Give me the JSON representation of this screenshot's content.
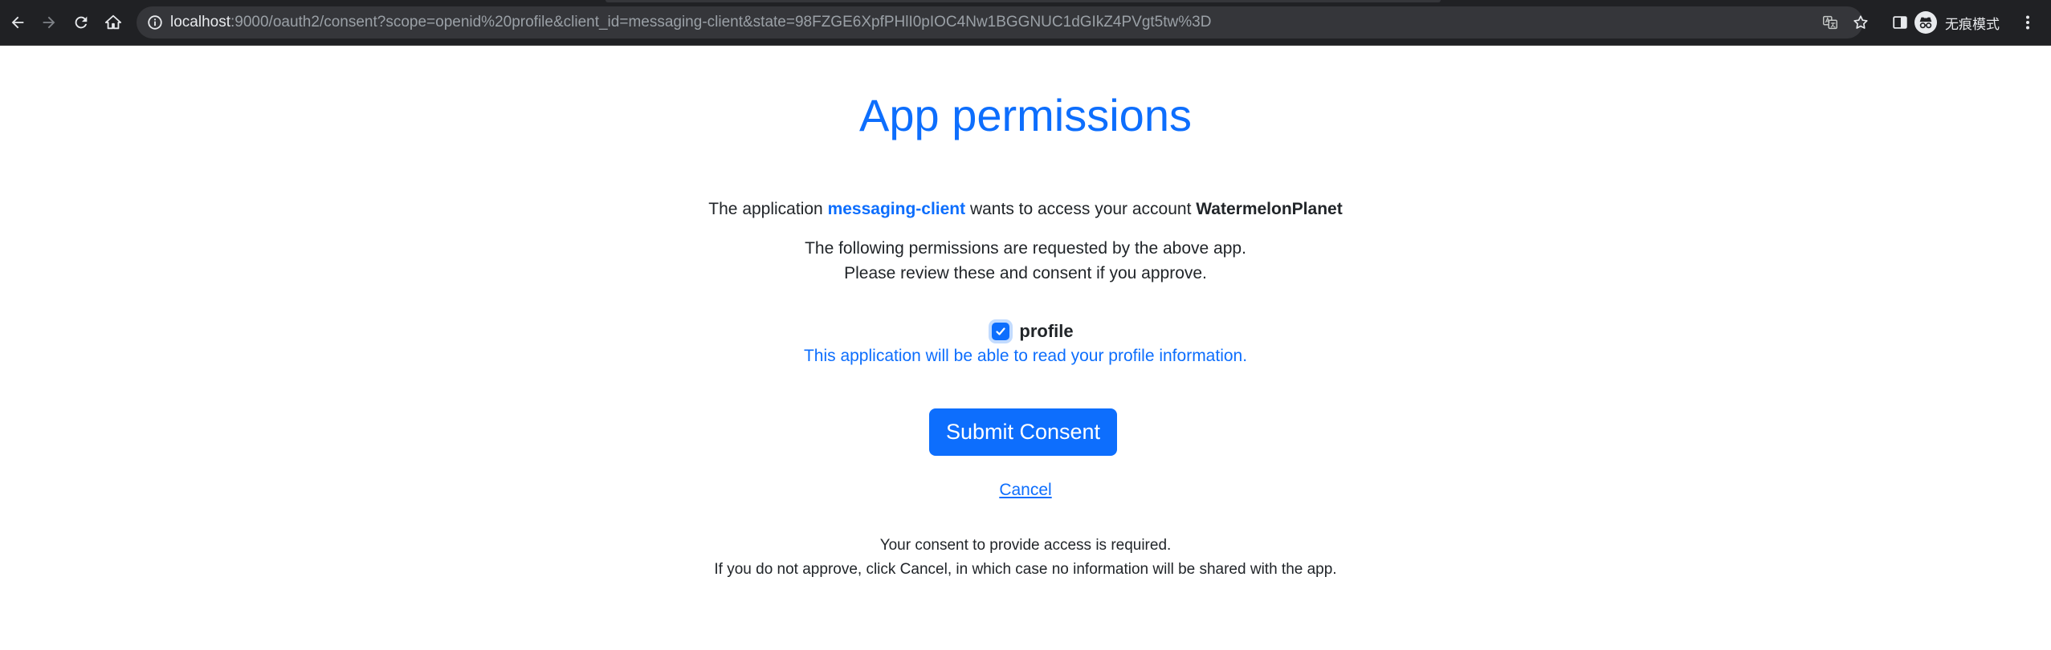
{
  "browser": {
    "url_host": "localhost",
    "url_rest": ":9000/oauth2/consent?scope=openid%20profile&client_id=messaging-client&state=98FZGE6XpfPHlI0pIOC4Nw1BGGNUC1dGIkZ4PVgt5tw%3D",
    "profile_label": "无痕模式",
    "icons": [
      "back-arrow-icon",
      "forward-arrow-icon",
      "reload-icon",
      "home-icon",
      "site-info-icon",
      "translate-icon",
      "bookmark-star-icon",
      "side-panel-icon",
      "incognito-icon",
      "menu-dots-icon"
    ],
    "colors": {
      "chrome_bg": "#202124",
      "omnibox_bg": "#35363a"
    }
  },
  "consent": {
    "title": "App permissions",
    "intro_prefix": "The application ",
    "client_id": "messaging-client",
    "intro_middle": " wants to access your account ",
    "account": "WatermelonPlanet",
    "request_line1": "The following permissions are requested by the above app.",
    "request_line2": "Please review these and consent if you approve.",
    "scope": {
      "name": "profile",
      "checked": true,
      "description": "This application will be able to read your profile information."
    },
    "submit_label": "Submit Consent",
    "cancel_label": "Cancel",
    "footer_line1": "Your consent to provide access is required.",
    "footer_line2": "If you do not approve, click Cancel, in which case no information will be shared with the app.",
    "colors": {
      "primary": "#0d6efd",
      "text": "#212529"
    }
  }
}
